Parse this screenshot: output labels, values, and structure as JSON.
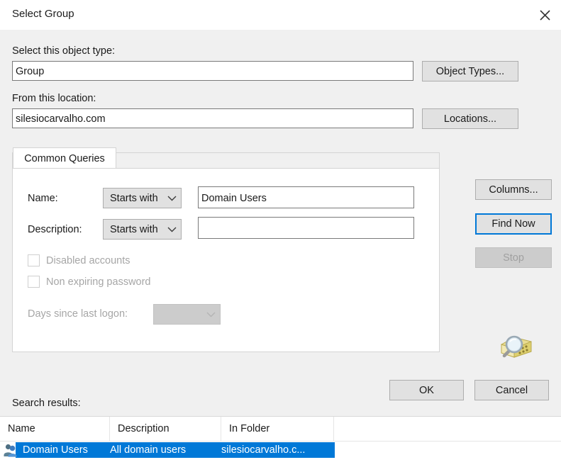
{
  "window": {
    "title": "Select Group",
    "close_icon": "close-icon"
  },
  "object_type": {
    "label": "Select this object type:",
    "value": "Group",
    "button_label": "Object Types..."
  },
  "location": {
    "label": "From this location:",
    "value": "silesiocarvalho.com",
    "button_label": "Locations..."
  },
  "tabs": [
    {
      "label": "Common Queries",
      "selected": true
    }
  ],
  "query": {
    "name": {
      "label": "Name:",
      "operator": "Starts with",
      "value": "Domain Users"
    },
    "description": {
      "label": "Description:",
      "operator": "Starts with",
      "value": ""
    },
    "disabled_accounts": {
      "label": "Disabled accounts",
      "checked": false,
      "enabled": false
    },
    "non_expiring_password": {
      "label": "Non expiring password",
      "checked": false,
      "enabled": false
    },
    "days_since_last_logon": {
      "label": "Days since last logon:",
      "value": "",
      "enabled": false
    }
  },
  "side_buttons": {
    "columns": "Columns...",
    "find_now": "Find Now",
    "stop": "Stop",
    "search_icon": "magnifier-folder-icon"
  },
  "dialog_buttons": {
    "ok": "OK",
    "cancel": "Cancel"
  },
  "search_results": {
    "label": "Search results:",
    "columns": [
      "Name",
      "Description",
      "In Folder"
    ],
    "rows": [
      {
        "icon": "group-icon",
        "name": "Domain Users",
        "description": "All domain users",
        "in_folder": "silesiocarvalho.c...",
        "selected": true
      }
    ]
  },
  "colors": {
    "accent": "#0078d7",
    "dialog_background": "#f0f0f0",
    "field_background": "#ffffff",
    "button_face": "#e1e1e1",
    "disabled_text": "#a6a6a6"
  }
}
